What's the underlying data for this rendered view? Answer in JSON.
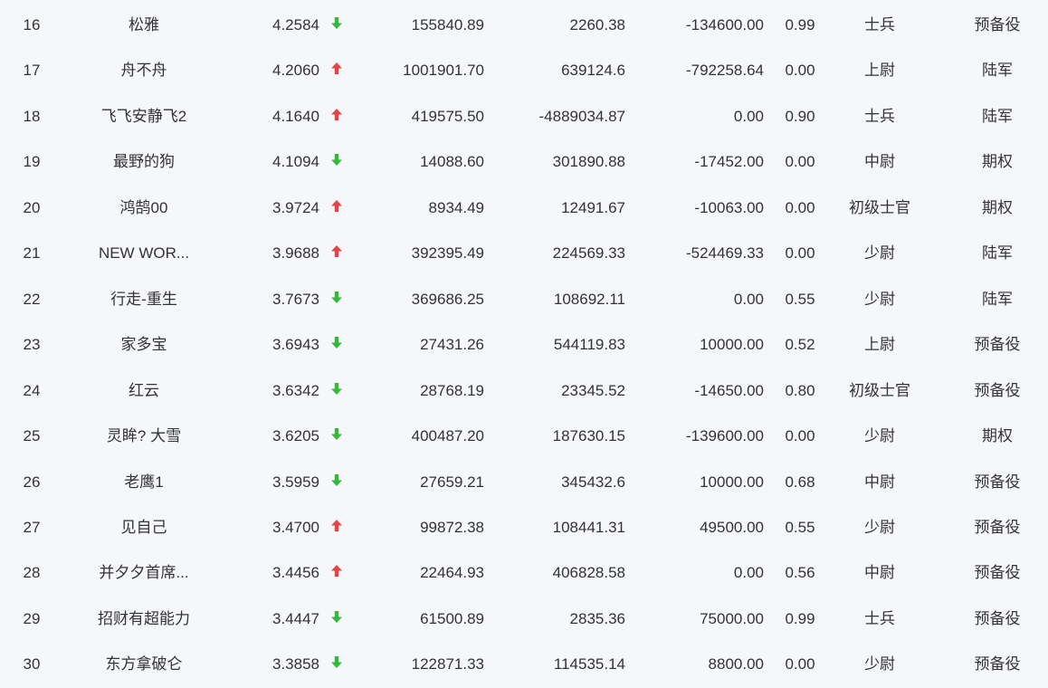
{
  "colors": {
    "up": "#e84343",
    "down": "#35b93b",
    "text": "#333333",
    "background": "#f6f7fb"
  },
  "rows": [
    {
      "rank": "16",
      "name": "松雅",
      "score": "4.2584",
      "trend": "down",
      "v1": "155840.89",
      "v2": "2260.38",
      "v3": "-134600.00",
      "ratio": "0.99",
      "title": "士兵",
      "branch": "预备役"
    },
    {
      "rank": "17",
      "name": "舟不舟",
      "score": "4.2060",
      "trend": "up",
      "v1": "1001901.70",
      "v2": "639124.6",
      "v3": "-792258.64",
      "ratio": "0.00",
      "title": "上尉",
      "branch": "陆军"
    },
    {
      "rank": "18",
      "name": "飞飞安静飞2",
      "score": "4.1640",
      "trend": "up",
      "v1": "419575.50",
      "v2": "-4889034.87",
      "v3": "0.00",
      "ratio": "0.90",
      "title": "士兵",
      "branch": "陆军"
    },
    {
      "rank": "19",
      "name": "最野的狗",
      "score": "4.1094",
      "trend": "down",
      "v1": "14088.60",
      "v2": "301890.88",
      "v3": "-17452.00",
      "ratio": "0.00",
      "title": "中尉",
      "branch": "期权"
    },
    {
      "rank": "20",
      "name": "鸿鹄00",
      "score": "3.9724",
      "trend": "up",
      "v1": "8934.49",
      "v2": "12491.67",
      "v3": "-10063.00",
      "ratio": "0.00",
      "title": "初级士官",
      "branch": "期权"
    },
    {
      "rank": "21",
      "name": "NEW WOR...",
      "score": "3.9688",
      "trend": "up",
      "v1": "392395.49",
      "v2": "224569.33",
      "v3": "-524469.33",
      "ratio": "0.00",
      "title": "少尉",
      "branch": "陆军"
    },
    {
      "rank": "22",
      "name": "行走-重生",
      "score": "3.7673",
      "trend": "down",
      "v1": "369686.25",
      "v2": "108692.11",
      "v3": "0.00",
      "ratio": "0.55",
      "title": "少尉",
      "branch": "陆军"
    },
    {
      "rank": "23",
      "name": "家多宝",
      "score": "3.6943",
      "trend": "down",
      "v1": "27431.26",
      "v2": "544119.83",
      "v3": "10000.00",
      "ratio": "0.52",
      "title": "上尉",
      "branch": "预备役"
    },
    {
      "rank": "24",
      "name": "红云",
      "score": "3.6342",
      "trend": "down",
      "v1": "28768.19",
      "v2": "23345.52",
      "v3": "-14650.00",
      "ratio": "0.80",
      "title": "初级士官",
      "branch": "预备役"
    },
    {
      "rank": "25",
      "name": "灵眸? 大雪",
      "score": "3.6205",
      "trend": "down",
      "v1": "400487.20",
      "v2": "187630.15",
      "v3": "-139600.00",
      "ratio": "0.00",
      "title": "少尉",
      "branch": "期权"
    },
    {
      "rank": "26",
      "name": "老鹰1",
      "score": "3.5959",
      "trend": "down",
      "v1": "27659.21",
      "v2": "345432.6",
      "v3": "10000.00",
      "ratio": "0.68",
      "title": "中尉",
      "branch": "预备役"
    },
    {
      "rank": "27",
      "name": "见自己",
      "score": "3.4700",
      "trend": "up",
      "v1": "99872.38",
      "v2": "108441.31",
      "v3": "49500.00",
      "ratio": "0.55",
      "title": "少尉",
      "branch": "预备役"
    },
    {
      "rank": "28",
      "name": "并夕夕首席...",
      "score": "3.4456",
      "trend": "up",
      "v1": "22464.93",
      "v2": "406828.58",
      "v3": "0.00",
      "ratio": "0.56",
      "title": "中尉",
      "branch": "预备役"
    },
    {
      "rank": "29",
      "name": "招财有超能力",
      "score": "3.4447",
      "trend": "down",
      "v1": "61500.89",
      "v2": "2835.36",
      "v3": "75000.00",
      "ratio": "0.99",
      "title": "士兵",
      "branch": "预备役"
    },
    {
      "rank": "30",
      "name": "东方拿破仑",
      "score": "3.3858",
      "trend": "down",
      "v1": "122871.33",
      "v2": "114535.14",
      "v3": "8800.00",
      "ratio": "0.00",
      "title": "少尉",
      "branch": "预备役"
    }
  ]
}
